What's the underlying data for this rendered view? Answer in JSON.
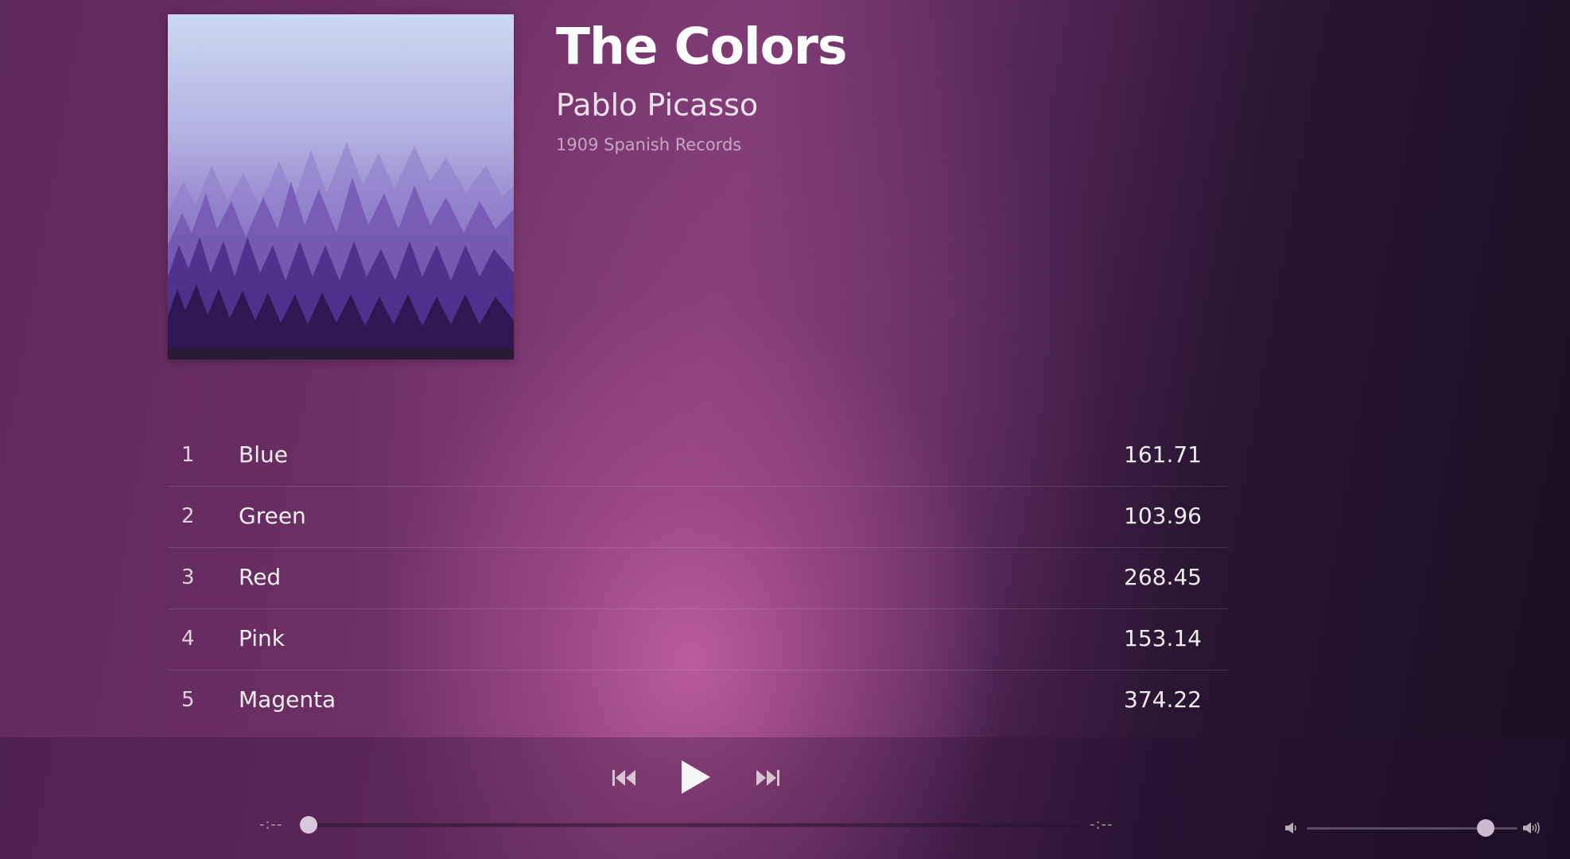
{
  "album": {
    "title": "The Colors",
    "artist": "Pablo Picasso",
    "release": "1909 Spanish Records",
    "art_icon": "forest-album-art"
  },
  "tracks": [
    {
      "number": "1",
      "name": "Blue",
      "duration": "161.71"
    },
    {
      "number": "2",
      "name": "Green",
      "duration": "103.96"
    },
    {
      "number": "3",
      "name": "Red",
      "duration": "268.45"
    },
    {
      "number": "4",
      "name": "Pink",
      "duration": "153.14"
    },
    {
      "number": "5",
      "name": "Magenta",
      "duration": "374.22"
    }
  ],
  "player": {
    "prev_icon": "skip-previous-icon",
    "play_icon": "play-icon",
    "next_icon": "skip-next-icon",
    "time_elapsed": "-:--",
    "time_total": "-:--",
    "progress_fraction": 0.0,
    "volume_fraction": 0.85,
    "volume_low_icon": "volume-low-icon",
    "volume_high_icon": "volume-high-icon"
  },
  "colors": {
    "background_pink": "#b45a95",
    "background_dark": "#1a0d22",
    "text": "#ffffff"
  }
}
